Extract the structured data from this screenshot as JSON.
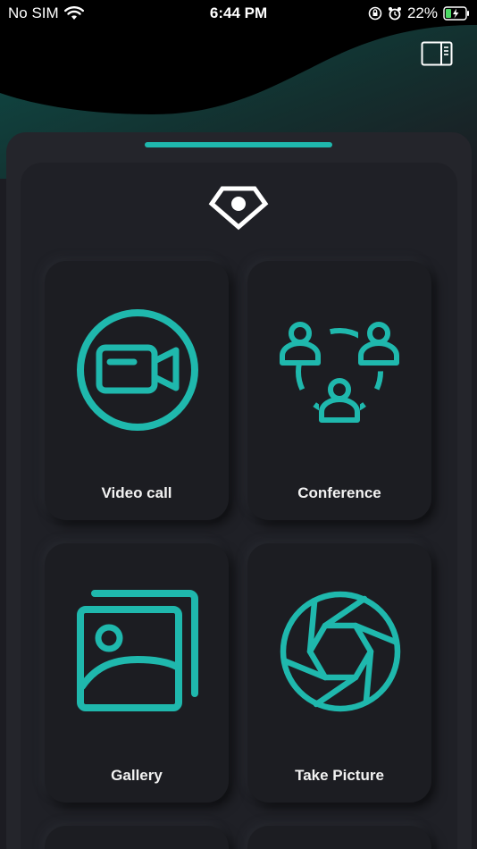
{
  "status_bar": {
    "carrier": "No SIM",
    "time": "6:44 PM",
    "battery": "22%"
  },
  "colors": {
    "accent": "#1fb8ad",
    "background": "#1c1c22",
    "tile": "#1c1d22"
  },
  "header": {
    "menu_icon": "sidebar-toggle-icon"
  },
  "logo": {
    "icon": "eye-diamond-icon"
  },
  "tiles": [
    {
      "label": "Video call",
      "icon": "video-camera-icon"
    },
    {
      "label": "Conference",
      "icon": "group-people-icon"
    },
    {
      "label": "Gallery",
      "icon": "gallery-images-icon"
    },
    {
      "label": "Take Picture",
      "icon": "camera-aperture-icon"
    }
  ]
}
